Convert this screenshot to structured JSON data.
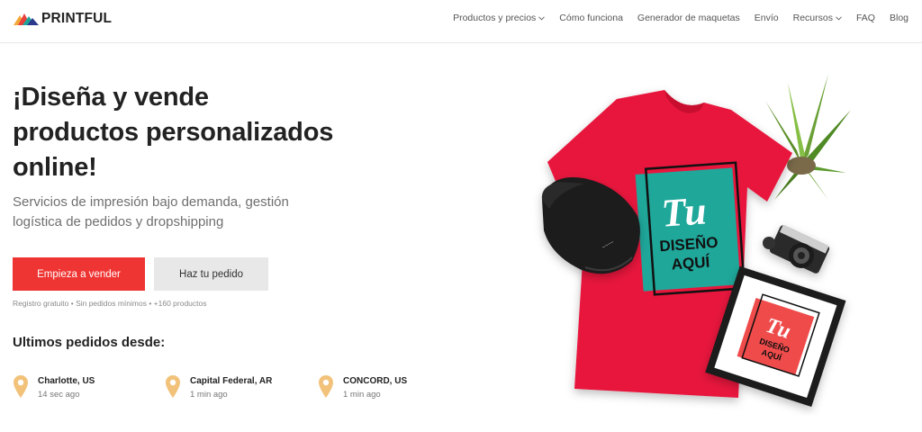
{
  "header": {
    "brand": "PRINTFUL",
    "nav": [
      {
        "label": "Productos y precios",
        "dropdown": true
      },
      {
        "label": "Cómo funciona",
        "dropdown": false
      },
      {
        "label": "Generador de maquetas",
        "dropdown": false
      },
      {
        "label": "Envío",
        "dropdown": false
      },
      {
        "label": "Recursos",
        "dropdown": true
      },
      {
        "label": "FAQ",
        "dropdown": false
      },
      {
        "label": "Blog",
        "dropdown": false
      }
    ]
  },
  "hero": {
    "title_line1": "¡Diseña y vende",
    "title_line2": "productos personalizados",
    "title_line3": "online!",
    "subtitle_line1": "Servicios de impresión bajo demanda, gestión",
    "subtitle_line2": "logística de pedidos y dropshipping",
    "primary_button": "Empieza a vender",
    "secondary_button": "Haz tu pedido",
    "note": "Registro gratuito • Sin pedidos mínimos • +160 productos"
  },
  "orders": {
    "title": "Ultimos pedidos desde:",
    "items": [
      {
        "city": "Charlotte, US",
        "time": "14 sec ago"
      },
      {
        "city": "Capital Federal, AR",
        "time": "1 min ago"
      },
      {
        "city": "CONCORD, US",
        "time": "1 min ago"
      }
    ]
  },
  "illustration": {
    "shirt_text_line1": "Tu",
    "shirt_text_line2": "DISEÑO",
    "shirt_text_line3": "AQUÍ",
    "frame_text_line1": "Tu",
    "frame_text_line2": "DISEÑO",
    "frame_text_line3": "AQUÍ"
  },
  "colors": {
    "accent": "#ef3533",
    "shirt": "#e8193c",
    "print_teal": "#1fa79a",
    "pin": "#f2c27a"
  },
  "icons": [
    "printful-logo-icon",
    "chevron-down-icon",
    "location-pin-icon"
  ]
}
